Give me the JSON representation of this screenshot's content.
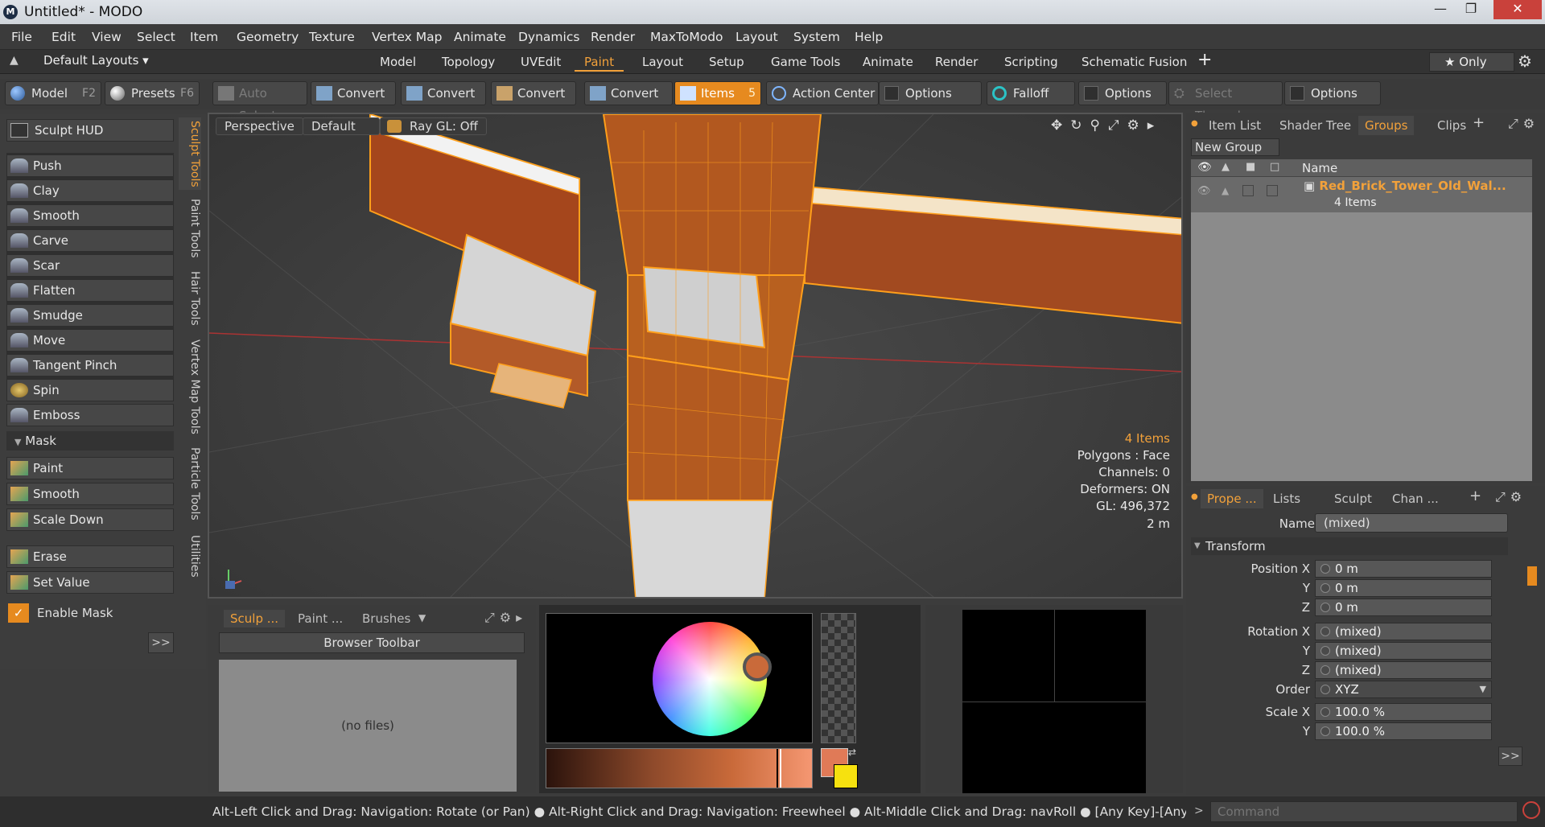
{
  "window": {
    "title": "Untitled* - MODO",
    "logo": "M"
  },
  "menu": [
    "File",
    "Edit",
    "View",
    "Select",
    "Item",
    "Geometry",
    "Texture",
    "Vertex Map",
    "Animate",
    "Dynamics",
    "Render",
    "MaxToModo",
    "Layout",
    "System",
    "Help"
  ],
  "layouts": {
    "preset": "Default Layouts ▾",
    "tabs": [
      "Model",
      "Topology",
      "UVEdit",
      "Paint",
      "Layout",
      "Setup",
      "Game Tools",
      "Animate",
      "Render",
      "Scripting",
      "Schematic Fusion"
    ],
    "active_tab": "Paint",
    "add": "+",
    "only": "★ Only"
  },
  "toolbar": {
    "model": "Model",
    "model_key": "F2",
    "presets": "Presets",
    "presets_key": "F6",
    "auto_select": "Auto Select",
    "convert": "Convert",
    "items": "Items",
    "items_key": "5",
    "action_center": "Action Center",
    "options": "Options",
    "falloff": "Falloff",
    "select_through": "Select Through"
  },
  "sculpt": {
    "hud": "Sculpt HUD",
    "tools": [
      "Push",
      "Clay",
      "Smooth",
      "Carve",
      "Scar",
      "Flatten",
      "Smudge",
      "Move",
      "Tangent Pinch",
      "Spin",
      "Emboss"
    ],
    "mask_header": "Mask",
    "mask_tools": [
      "Paint",
      "Smooth",
      "Scale Down"
    ],
    "other_tools": [
      "Erase",
      "Set Value"
    ],
    "enable_mask": "Enable Mask",
    "more": ">>"
  },
  "side_tabs": [
    "Sculpt Tools",
    "Paint Tools",
    "Hair Tools",
    "Vertex Map Tools",
    "Particle Tools",
    "Utilities"
  ],
  "viewport": {
    "view": "Perspective",
    "shading": "Default",
    "raygl": "Ray GL: Off",
    "info": [
      "4 Items",
      "Polygons : Face",
      "Channels: 0",
      "Deformers: ON",
      "GL: 496,372",
      "2 m"
    ]
  },
  "browser": {
    "tabs": [
      "Sculp ...",
      "Paint ...",
      "Brushes"
    ],
    "toolbar": "Browser Toolbar",
    "empty": "(no files)"
  },
  "right": {
    "tabs": [
      "Item List",
      "Shader Tree",
      "Groups",
      "Clips"
    ],
    "active": "Groups",
    "new_group": "New Group",
    "name_col": "Name",
    "group_name": "Red_Brick_Tower_Old_Wal...",
    "group_count": "4 Items"
  },
  "properties": {
    "tabs": [
      "Prope ...",
      "Lists",
      "Sculpt",
      "Chan ..."
    ],
    "name_label": "Name",
    "name_value": "(mixed)",
    "transform": "Transform",
    "rows": [
      {
        "label": "Position X",
        "value": "0 m"
      },
      {
        "label": "Y",
        "value": "0 m"
      },
      {
        "label": "Z",
        "value": "0 m"
      },
      {
        "label": "Rotation X",
        "value": "(mixed)"
      },
      {
        "label": "Y",
        "value": "(mixed)"
      },
      {
        "label": "Z",
        "value": "(mixed)"
      },
      {
        "label": "Order",
        "value": "XYZ"
      },
      {
        "label": "Scale X",
        "value": "100.0 %"
      },
      {
        "label": "Y",
        "value": "100.0 %"
      }
    ],
    "more": ">>"
  },
  "status": "Alt-Left Click and Drag: Navigation: Rotate (or Pan) ● Alt-Right Click and Drag: Navigation: Freewheel ● Alt-Middle Click and Drag: navRoll ● [Any Key]-[Any Button] Click an ...",
  "command_placeholder": "Command",
  "colors": {
    "accent": "#f2a13a",
    "brick": "#a9501f",
    "wire": "#ff9f1a"
  }
}
